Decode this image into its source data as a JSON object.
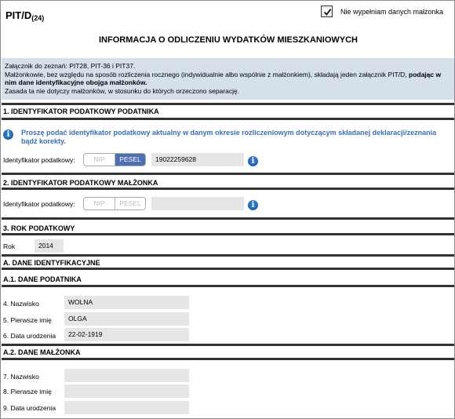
{
  "header": {
    "form_code": "PIT/D",
    "form_version": "(24)",
    "spouse_checkbox_label": "Nie wypełniam danych małżonka",
    "spouse_checkbox_checked": true,
    "title": "INFORMACJA O ODLICZENIU WYDATKÓW MIESZKANIOWYCH"
  },
  "notice": {
    "line1": "Załącznik do zeznań: PIT28, PIT-36 i PIT37.",
    "line2_start": "Małżonkowie, bez względu na sposób rozliczenia rocznego (indywidualnie albo wspólnie z małżonkiem), składają jeden załącznik PIT/D,",
    "line2_bold": "podając w nim dane identyfikacyjne obojga małżonków.",
    "line3": "Zasada ta nie dotyczy małżonków, w stosunku do których orzeczono separację."
  },
  "section1": {
    "title": "1. IDENTYFIKATOR PODATKOWY PODATNIKA",
    "hint": "Proszę podać identyfikator podatkowy aktualny w danym okresie rozliczeniowym dotyczącym składanej deklaracji/zeznania bądź korekty.",
    "id_label": "Identyfikator podatkowy:",
    "options": [
      "NIP",
      "PESEL"
    ],
    "selected": "PESEL",
    "id_value": "19022259628"
  },
  "section2": {
    "title": "2. IDENTYFIKATOR PODATKOWY MAŁŻONKA",
    "id_label": "Identyfikator podatkowy:",
    "options": [
      "NIP",
      "PESEL"
    ],
    "id_value": ""
  },
  "section3": {
    "title": "3. ROK PODATKOWY",
    "year_label": "Rok",
    "year_value": "2014"
  },
  "sectionA": {
    "title": "A. DANE IDENTYFIKACYJNE",
    "a1_title": "A.1. DANE PODATNIKA",
    "taxpayer": {
      "surname_label": "4. Nazwisko",
      "surname_value": "WOLNA",
      "first_name_label": "5. Pierwsze imię",
      "first_name_value": "OLGA",
      "birth_date_label": "6. Data urodzenia",
      "birth_date_value": "22-02-1919"
    },
    "a2_title": "A.2. DANE MAŁŻONKA",
    "spouse": {
      "surname_label": "7. Nazwisko",
      "surname_value": "",
      "first_name_label": "8. Pierwsze imię",
      "first_name_value": "",
      "birth_date_label": "9. Data urodzenia",
      "birth_date_value": ""
    }
  },
  "colors": {
    "section_bar": "#333333",
    "notice_bg": "#d6e0ea",
    "toggle_active": "#4b6fb0",
    "hint_text": "#3a6fb5",
    "info_icon": "#2a75c8",
    "field_bg": "#e6e6e6"
  }
}
